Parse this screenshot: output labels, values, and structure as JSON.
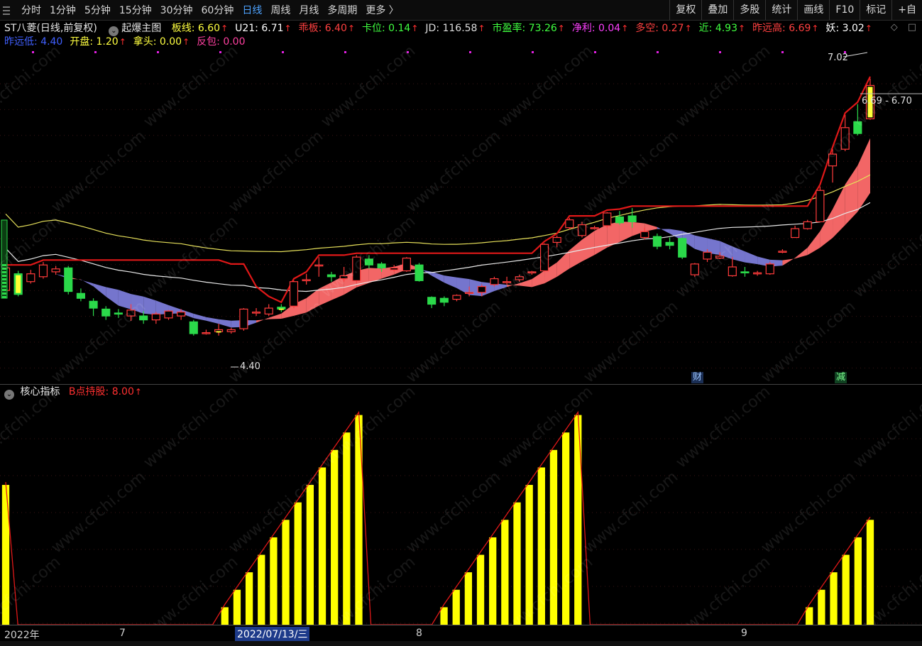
{
  "toolbar": {
    "periods": [
      "分时",
      "1分钟",
      "5分钟",
      "15分钟",
      "30分钟",
      "60分钟",
      "日线",
      "周线",
      "月线",
      "多周期",
      "更多 〉"
    ],
    "active_period": "日线",
    "right_buttons": [
      "复权",
      "叠加",
      "多股",
      "统计",
      "画线",
      "F10",
      "标记",
      "+自"
    ]
  },
  "legend": {
    "title": "ST八菱(日线,前复权)",
    "indicator": "起爆主图",
    "row1": [
      {
        "label": "板线",
        "value": "6.60",
        "color": "#ffff40",
        "up": true
      },
      {
        "label": "U21",
        "value": "6.71",
        "color": "#ffffff",
        "up": true
      },
      {
        "label": "乖板",
        "value": "6.40",
        "color": "#ff4040",
        "up": true
      },
      {
        "label": "卡位",
        "value": "0.14",
        "color": "#40ff40",
        "up": true
      },
      {
        "label": "JD",
        "value": "116.58",
        "color": "#dddddd",
        "up": true
      },
      {
        "label": "市盈率",
        "value": "73.26",
        "color": "#40ff40",
        "up": true
      },
      {
        "label": "净利",
        "value": "0.04",
        "color": "#ff40ff",
        "up": true
      },
      {
        "label": "多空",
        "value": "0.27",
        "color": "#ff4040",
        "up": true
      },
      {
        "label": "近",
        "value": "4.93",
        "color": "#40ff40",
        "up": true
      },
      {
        "label": "昨远高",
        "value": "6.69",
        "color": "#ff4040",
        "up": true
      },
      {
        "label": "妖",
        "value": "3.02",
        "color": "#ffffff",
        "up": true
      }
    ],
    "row2": [
      {
        "label": "昨远低",
        "value": "4.40",
        "color": "#4060ff",
        "up": false
      },
      {
        "label": "开盘",
        "value": "1.20",
        "color": "#ffff40",
        "up": true
      },
      {
        "label": "拿头",
        "value": "0.00",
        "color": "#ffff40",
        "up": true
      },
      {
        "label": "反包",
        "value": "0.00",
        "color": "#ff40a0",
        "up": false
      }
    ]
  },
  "lower_legend": {
    "title": "核心指标",
    "label": "B点持股",
    "value": "8.00",
    "color": "#ff3030"
  },
  "annotations": {
    "high": "7.02",
    "low": "4.40",
    "range": "6.69 - 6.70",
    "marker1": "财",
    "marker2": "减"
  },
  "axis": {
    "labels": [
      "2022年",
      "7",
      "8",
      "9"
    ],
    "highlight": "2022/07/13/三"
  },
  "watermark": "www.cfchi.com",
  "colors": {
    "up": "#ff3b3b",
    "down": "#2bd94a",
    "yellow": "#ffff33",
    "accent": "#4ea3ff"
  },
  "chart_data": [
    {
      "type": "candlestick",
      "title": "ST八菱(日线,前复权)",
      "price_range": [
        4.0,
        7.3
      ],
      "candles": [
        {
          "o": 4.86,
          "c": 5.09,
          "h": 5.1,
          "l": 4.83
        },
        {
          "o": 5.03,
          "c": 4.82,
          "h": 5.06,
          "l": 4.8
        },
        {
          "o": 4.95,
          "c": 5.03,
          "h": 5.07,
          "l": 4.93
        },
        {
          "o": 5.0,
          "c": 5.12,
          "h": 5.15,
          "l": 4.98
        },
        {
          "o": 5.05,
          "c": 5.08,
          "h": 5.11,
          "l": 5.02
        },
        {
          "o": 5.09,
          "c": 4.85,
          "h": 5.11,
          "l": 4.82
        },
        {
          "o": 4.83,
          "c": 4.78,
          "h": 4.88,
          "l": 4.75
        },
        {
          "o": 4.75,
          "c": 4.68,
          "h": 4.78,
          "l": 4.6
        },
        {
          "o": 4.67,
          "c": 4.6,
          "h": 4.7,
          "l": 4.56
        },
        {
          "o": 4.63,
          "c": 4.62,
          "h": 4.67,
          "l": 4.58
        },
        {
          "o": 4.6,
          "c": 4.66,
          "h": 4.72,
          "l": 4.55
        },
        {
          "o": 4.6,
          "c": 4.56,
          "h": 4.65,
          "l": 4.52
        },
        {
          "o": 4.56,
          "c": 4.62,
          "h": 4.64,
          "l": 4.52
        },
        {
          "o": 4.58,
          "c": 4.65,
          "h": 4.66,
          "l": 4.56
        },
        {
          "o": 4.6,
          "c": 4.64,
          "h": 4.67,
          "l": 4.56
        },
        {
          "o": 4.54,
          "c": 4.42,
          "h": 4.56,
          "l": 4.4
        },
        {
          "o": 4.43,
          "c": 4.43,
          "h": 4.46,
          "l": 4.41
        },
        {
          "o": 4.44,
          "c": 4.46,
          "h": 4.52,
          "l": 4.4
        },
        {
          "o": 4.44,
          "c": 4.46,
          "h": 4.48,
          "l": 4.42
        },
        {
          "o": 4.47,
          "c": 4.67,
          "h": 4.68,
          "l": 4.45
        },
        {
          "o": 4.63,
          "c": 4.64,
          "h": 4.68,
          "l": 4.6
        },
        {
          "o": 4.62,
          "c": 4.68,
          "h": 4.72,
          "l": 4.6
        },
        {
          "o": 4.69,
          "c": 4.67,
          "h": 4.72,
          "l": 4.64
        },
        {
          "o": 4.7,
          "c": 4.95,
          "h": 4.96,
          "l": 4.68
        },
        {
          "o": 4.96,
          "c": 4.97,
          "h": 5.03,
          "l": 4.92
        },
        {
          "o": 5.12,
          "c": 5.12,
          "h": 5.2,
          "l": 5.0
        },
        {
          "o": 5.02,
          "c": 5.0,
          "h": 5.05,
          "l": 4.95
        },
        {
          "o": 4.98,
          "c": 5.01,
          "h": 5.1,
          "l": 4.95
        },
        {
          "o": 4.96,
          "c": 5.2,
          "h": 5.22,
          "l": 4.94
        },
        {
          "o": 5.18,
          "c": 5.12,
          "h": 5.22,
          "l": 5.08
        },
        {
          "o": 5.13,
          "c": 5.09,
          "h": 5.15,
          "l": 5.05
        },
        {
          "o": 5.07,
          "c": 5.09,
          "h": 5.12,
          "l": 5.05
        },
        {
          "o": 5.06,
          "c": 5.19,
          "h": 5.2,
          "l": 5.05
        },
        {
          "o": 5.12,
          "c": 4.96,
          "h": 5.14,
          "l": 4.95
        },
        {
          "o": 4.79,
          "c": 4.72,
          "h": 4.8,
          "l": 4.68
        },
        {
          "o": 4.78,
          "c": 4.74,
          "h": 4.8,
          "l": 4.7
        },
        {
          "o": 4.77,
          "c": 4.81,
          "h": 4.82,
          "l": 4.75
        },
        {
          "o": 4.83,
          "c": 4.84,
          "h": 4.9,
          "l": 4.8
        },
        {
          "o": 4.84,
          "c": 4.9,
          "h": 4.92,
          "l": 4.8
        },
        {
          "o": 4.92,
          "c": 4.98,
          "h": 5.0,
          "l": 4.9
        },
        {
          "o": 4.95,
          "c": 4.95,
          "h": 5.0,
          "l": 4.92
        },
        {
          "o": 4.97,
          "c": 5.0,
          "h": 5.02,
          "l": 4.95
        },
        {
          "o": 5.04,
          "c": 5.05,
          "h": 5.06,
          "l": 5.02
        },
        {
          "o": 5.06,
          "c": 5.33,
          "h": 5.34,
          "l": 5.05
        },
        {
          "o": 5.35,
          "c": 5.4,
          "h": 5.42,
          "l": 5.3
        },
        {
          "o": 5.5,
          "c": 5.58,
          "h": 5.6,
          "l": 5.48
        },
        {
          "o": 5.42,
          "c": 5.53,
          "h": 5.56,
          "l": 5.4
        },
        {
          "o": 5.5,
          "c": 5.5,
          "h": 5.52,
          "l": 5.48
        },
        {
          "o": 5.52,
          "c": 5.65,
          "h": 5.66,
          "l": 5.5
        },
        {
          "o": 5.61,
          "c": 5.55,
          "h": 5.67,
          "l": 5.53
        },
        {
          "o": 5.62,
          "c": 5.56,
          "h": 5.7,
          "l": 5.5
        },
        {
          "o": 5.4,
          "c": 5.46,
          "h": 5.5,
          "l": 5.38
        },
        {
          "o": 5.41,
          "c": 5.31,
          "h": 5.44,
          "l": 5.28
        },
        {
          "o": 5.35,
          "c": 5.32,
          "h": 5.4,
          "l": 5.28
        },
        {
          "o": 5.39,
          "c": 5.2,
          "h": 5.4,
          "l": 5.18
        },
        {
          "o": 5.02,
          "c": 5.13,
          "h": 5.14,
          "l": 5.0
        },
        {
          "o": 5.18,
          "c": 5.25,
          "h": 5.28,
          "l": 5.15
        },
        {
          "o": 5.19,
          "c": 5.21,
          "h": 5.25,
          "l": 5.18
        },
        {
          "o": 5.01,
          "c": 5.1,
          "h": 5.2,
          "l": 5.0
        },
        {
          "o": 5.05,
          "c": 5.04,
          "h": 5.1,
          "l": 5.0
        },
        {
          "o": 5.03,
          "c": 5.04,
          "h": 5.06,
          "l": 5.01
        },
        {
          "o": 5.03,
          "c": 5.13,
          "h": 5.15,
          "l": 5.02
        },
        {
          "o": 5.26,
          "c": 5.26,
          "h": 5.28,
          "l": 5.24
        },
        {
          "o": 5.4,
          "c": 5.49,
          "h": 5.52,
          "l": 5.4
        },
        {
          "o": 5.49,
          "c": 5.56,
          "h": 5.58,
          "l": 5.48
        },
        {
          "o": 5.56,
          "c": 5.88,
          "h": 5.92,
          "l": 5.56
        },
        {
          "o": 6.13,
          "c": 6.25,
          "h": 6.3,
          "l": 5.96
        },
        {
          "o": 6.3,
          "c": 6.52,
          "h": 6.65,
          "l": 6.28
        },
        {
          "o": 6.58,
          "c": 6.46,
          "h": 6.76,
          "l": 6.44
        },
        {
          "o": 6.61,
          "c": 6.95,
          "h": 7.02,
          "l": 6.6
        }
      ]
    },
    {
      "type": "bar",
      "title": "核心指标",
      "series_name": "B点持股",
      "values": [
        8,
        0,
        0,
        0,
        0,
        0,
        0,
        0,
        0,
        0,
        0,
        0,
        0,
        0,
        0,
        0,
        0,
        0,
        1,
        2,
        3,
        4,
        5,
        6,
        7,
        8,
        9,
        10,
        11,
        12,
        0,
        0,
        0,
        0,
        0,
        0,
        1,
        2,
        3,
        4,
        5,
        6,
        7,
        8,
        9,
        10,
        11,
        12,
        0,
        0,
        0,
        0,
        0,
        0,
        0,
        0,
        0,
        0,
        0,
        0,
        0,
        0,
        0,
        0,
        0,
        0,
        1,
        2,
        3,
        4,
        5,
        6
      ],
      "ylim": [
        0,
        13
      ]
    }
  ]
}
